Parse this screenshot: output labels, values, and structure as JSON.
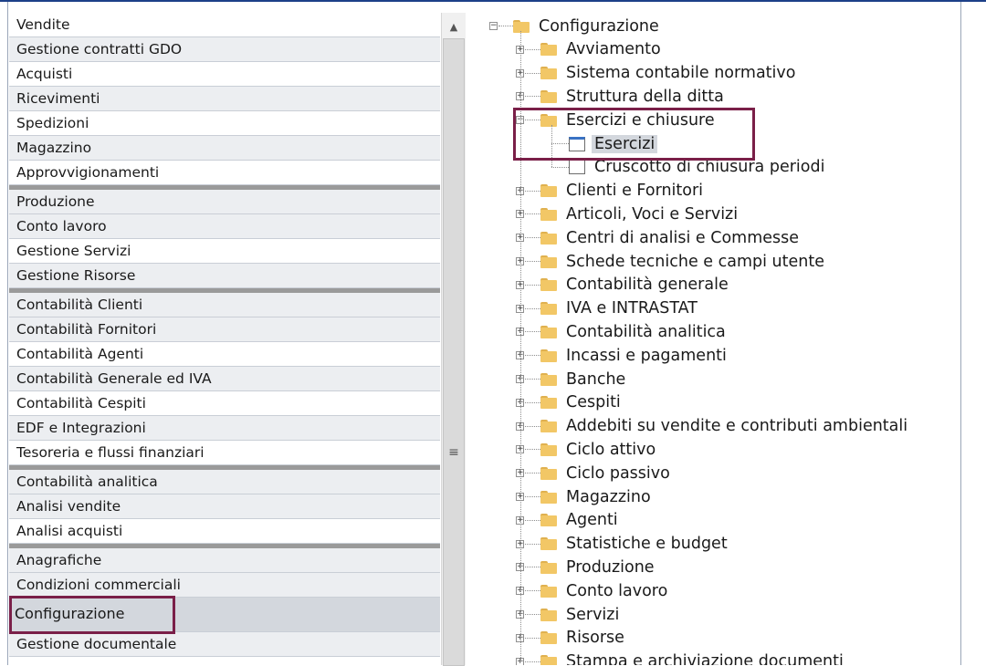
{
  "menu": {
    "groups": [
      [
        "Vendite",
        "Gestione contratti GDO",
        "Acquisti",
        "Ricevimenti",
        "Spedizioni",
        "Magazzino",
        "Approvvigionamenti"
      ],
      [
        "Produzione",
        "Conto lavoro",
        "Gestione Servizi",
        "Gestione Risorse"
      ],
      [
        "Contabilità Clienti",
        "Contabilità Fornitori",
        "Contabilità Agenti",
        "Contabilità Generale ed IVA",
        "Contabilità Cespiti",
        "EDF e Integrazioni",
        "Tesoreria e flussi finanziari"
      ],
      [
        "Contabilità analitica",
        "Analisi vendite",
        "Analisi acquisti"
      ],
      [
        "Anagrafiche",
        "Condizioni commerciali",
        "Configurazione",
        "Gestione documentale"
      ]
    ],
    "selected": "Configurazione"
  },
  "scrollbar": {
    "up_icon": "▲",
    "grip_icon": "≡"
  },
  "tree": {
    "root": "Configurazione",
    "expanded_node": "Esercizi e chiusure",
    "before": [
      "Avviamento",
      "Sistema contabile normativo",
      "Struttura della ditta"
    ],
    "children": [
      {
        "label": "Esercizi",
        "selected": true
      },
      {
        "label": "Cruscotto di chiusura periodi",
        "selected": false
      }
    ],
    "after": [
      "Clienti e Fornitori",
      "Articoli, Voci e Servizi",
      "Centri di analisi e Commesse",
      "Schede tecniche e campi utente",
      "Contabilità generale",
      "IVA e INTRASTAT",
      "Contabilità analitica",
      "Incassi e pagamenti",
      "Banche",
      "Cespiti",
      "Addebiti su vendite e contributi ambientali",
      "Ciclo attivo",
      "Ciclo passivo",
      "Magazzino",
      "Agenti",
      "Statistiche e budget",
      "Produzione",
      "Conto lavoro",
      "Servizi",
      "Risorse",
      "Stampa e archiviazione documenti"
    ]
  },
  "colors": {
    "accent": "#7a1f48",
    "folder": "#f2c766",
    "selected_bg": "#d3d7dd",
    "shaded_row": "#eceef1"
  }
}
